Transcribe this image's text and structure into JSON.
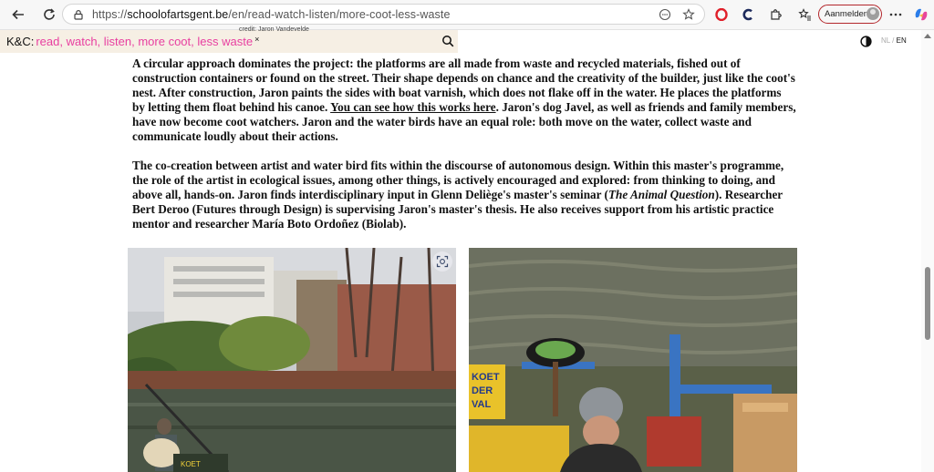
{
  "browser": {
    "url_prefix": "https://",
    "url_host": "schoolofartsgent.be",
    "url_path": "/en/read-watch-listen/more-coot-less-waste",
    "signin_label": "Aanmelden"
  },
  "site": {
    "logo": "K&C:",
    "tagline": "read, watch, listen, more coot, less waste",
    "close": "×",
    "credit": "credit: Jaron Vandevelde",
    "lang_nl": "NL",
    "lang_sep": "/",
    "lang_en": "EN"
  },
  "article": {
    "p1_a": "A circular approach dominates the project: the platforms are all made from waste and recycled materials, fished out of construction containers or found on the street. Their shape depends on chance and the creativity of the builder, just like the coot's nest. After construction, Jaron paints the sides with boat varnish, which does not flake off in the water. He places the platforms by letting them float behind his canoe. ",
    "p1_link": "You can see how this works here",
    "p1_b": ". Jaron's dog Javel, as well as friends and family members, have now become coot watchers. Jaron and the water birds have an equal role: both move on the water, collect waste and communicate loudly about their actions.",
    "p2_a": "The co-creation between artist and water bird fits within the discourse of autonomous design. Within this master's programme, the role of the artist in ecological issues, among other things, is actively encouraged and explored: from thinking to doing, and above all, hands-on. Jaron finds interdisciplinary input in Glenn Deliège's master's seminar (",
    "p2_italic": "The Animal Question",
    "p2_b": "). Researcher Bert Deroo (Futures through Design) is supervising Jaron's master's thesis. He also receives support from his artistic practice mentor and researcher María Boto Ordoñez (Biolab)."
  },
  "photos": {
    "left_sign": "KOET",
    "right_sign_1": "KOET",
    "right_sign_2": "DER",
    "right_sign_3": "VAL"
  }
}
